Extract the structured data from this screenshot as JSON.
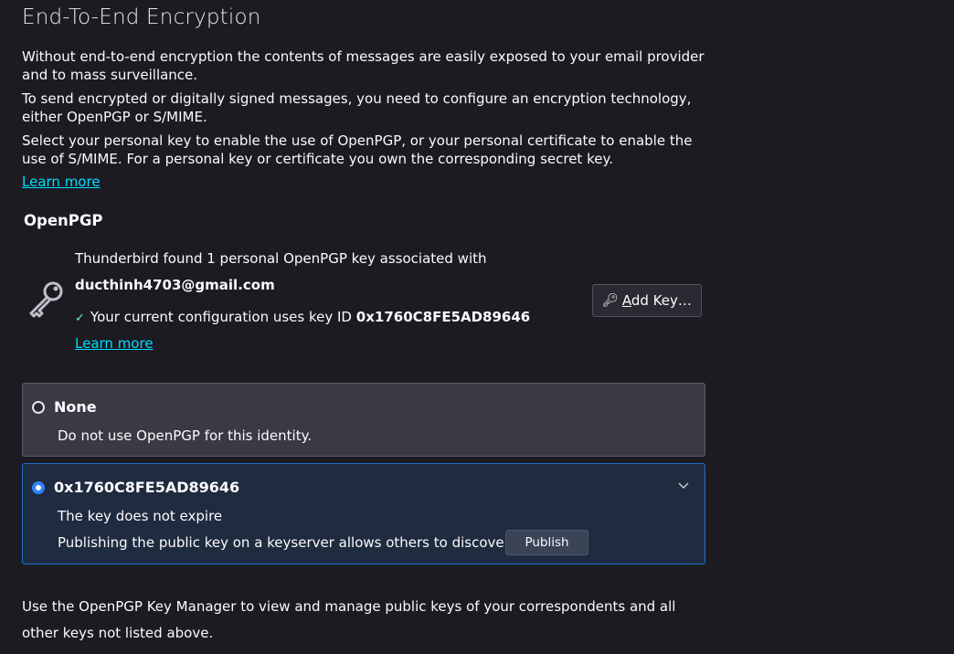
{
  "section": {
    "title": "End-To-End Encryption",
    "intro_1": "Without end-to-end encryption the contents of messages are easily exposed to your email provider and to mass surveillance.",
    "intro_2": "To send encrypted or digitally signed messages, you need to configure an encryption technology, either OpenPGP or S/MIME.",
    "intro_3": "Select your personal key to enable the use of OpenPGP, or your personal certificate to enable the use of S/MIME. For a personal key or certificate you own the corresponding secret key.",
    "learn_more": "Learn more"
  },
  "openpgp": {
    "heading": "OpenPGP",
    "found_text": "Thunderbird found 1 personal OpenPGP key associated with",
    "email": "ducthinh4703@gmail.com",
    "config_prefix": "Your current configuration uses key ID",
    "config_key_id": "0x1760C8FE5AD89646",
    "learn_more": "Learn more",
    "add_key_label_rest": "dd Key…",
    "add_key_label_access": "A",
    "icon": "key-icon"
  },
  "options": {
    "none": {
      "title": "None",
      "description": "Do not use OpenPGP for this identity.",
      "selected": false
    },
    "key": {
      "title": "0x1760C8FE5AD89646",
      "expiry": "The key does not expire",
      "publish_text": "Publishing the public key on a keyserver allows others to discover it.",
      "publish_label": "Publish",
      "selected": true
    }
  },
  "footer": {
    "text": "Use the OpenPGP Key Manager to view and manage public keys of your correspondents and all other keys not listed above."
  },
  "colors": {
    "background": "#1c1b22",
    "link": "#00ddff",
    "accent": "#2f83ff",
    "check": "#54ffbd"
  }
}
